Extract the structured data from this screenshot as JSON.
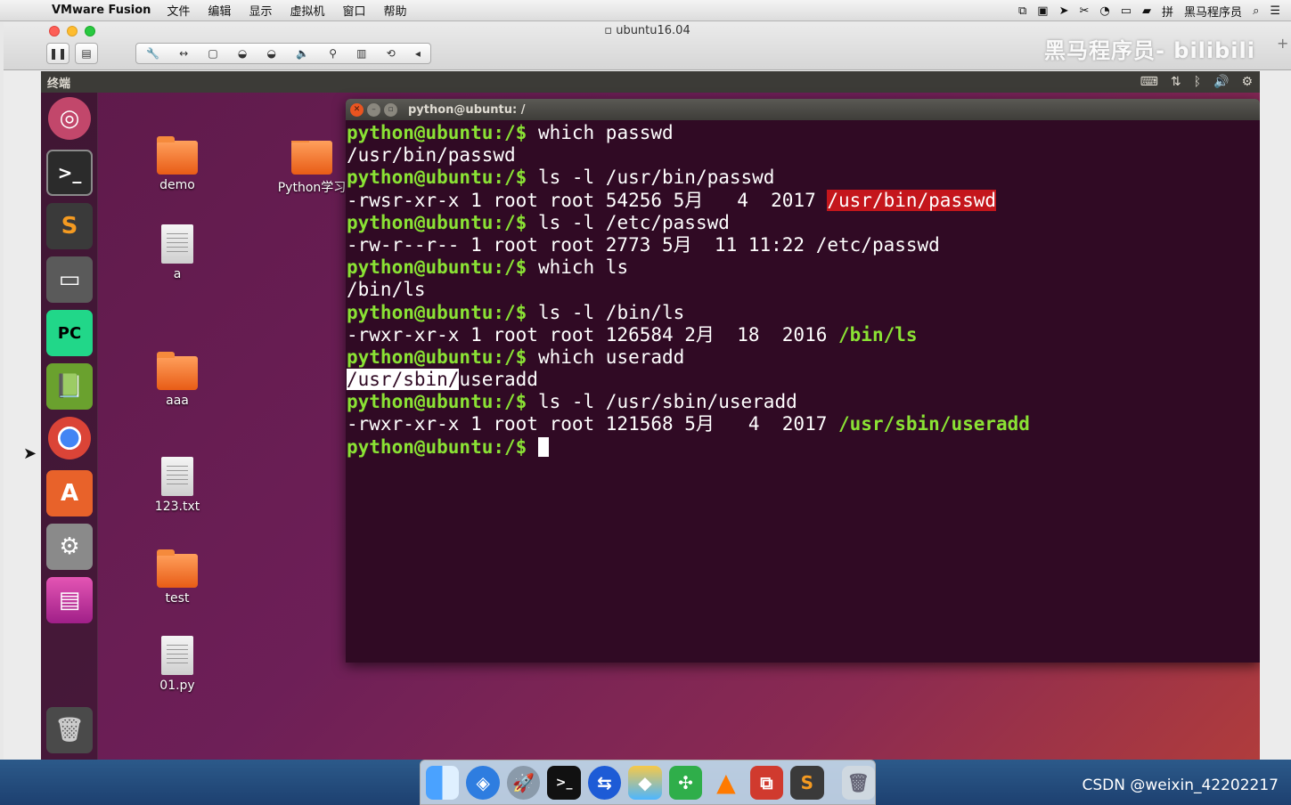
{
  "menubar": {
    "app_name": "VMware Fusion",
    "menus": [
      "文件",
      "编辑",
      "显示",
      "虚拟机",
      "窗口",
      "帮助"
    ],
    "right_label": "黑马程序员"
  },
  "window": {
    "title": "ubuntu16.04",
    "watermark": "黑马程序员- bilibili"
  },
  "guest": {
    "topbar_title": "终端"
  },
  "desktop": {
    "icons": [
      {
        "label": "demo",
        "kind": "folder"
      },
      {
        "label": "Python学习",
        "kind": "folder"
      },
      {
        "label": "a",
        "kind": "file"
      },
      {
        "label": "aaa",
        "kind": "folder"
      },
      {
        "label": "123.txt",
        "kind": "file"
      },
      {
        "label": "test",
        "kind": "folder"
      },
      {
        "label": "01.py",
        "kind": "file"
      }
    ]
  },
  "terminal": {
    "title": "python@ubuntu: /",
    "prompt": "python@ubuntu:/$ ",
    "lines": [
      {
        "type": "cmd",
        "text": "which passwd"
      },
      {
        "type": "out",
        "text": "/usr/bin/passwd"
      },
      {
        "type": "cmd",
        "text": "ls -l /usr/bin/passwd"
      },
      {
        "type": "ls",
        "pre": "-rwsr-xr-x 1 root root 54256 5月   4  2017 ",
        "hl": "/usr/bin/passwd",
        "style": "red"
      },
      {
        "type": "cmd",
        "text": "ls -l /etc/passwd"
      },
      {
        "type": "out",
        "text": "-rw-r--r-- 1 root root 2773 5月  11 11:22 /etc/passwd"
      },
      {
        "type": "cmd",
        "text": "which ls"
      },
      {
        "type": "out",
        "text": "/bin/ls"
      },
      {
        "type": "cmd",
        "text": "ls -l /bin/ls"
      },
      {
        "type": "ls",
        "pre": "-rwxr-xr-x 1 root root 126584 2月  18  2016 ",
        "hl": "/bin/ls",
        "style": "green"
      },
      {
        "type": "cmd",
        "text": "which useradd"
      },
      {
        "type": "sel",
        "sel": "/usr/sbin/",
        "rest": "useradd"
      },
      {
        "type": "cmd",
        "text": "ls -l /usr/sbin/useradd"
      },
      {
        "type": "ls",
        "pre": "-rwxr-xr-x 1 root root 121568 5月   4  2017 ",
        "hl": "/usr/sbin/useradd",
        "style": "green"
      },
      {
        "type": "cursor"
      }
    ]
  },
  "footer": {
    "csdn": "CSDN @weixin_42202217"
  }
}
